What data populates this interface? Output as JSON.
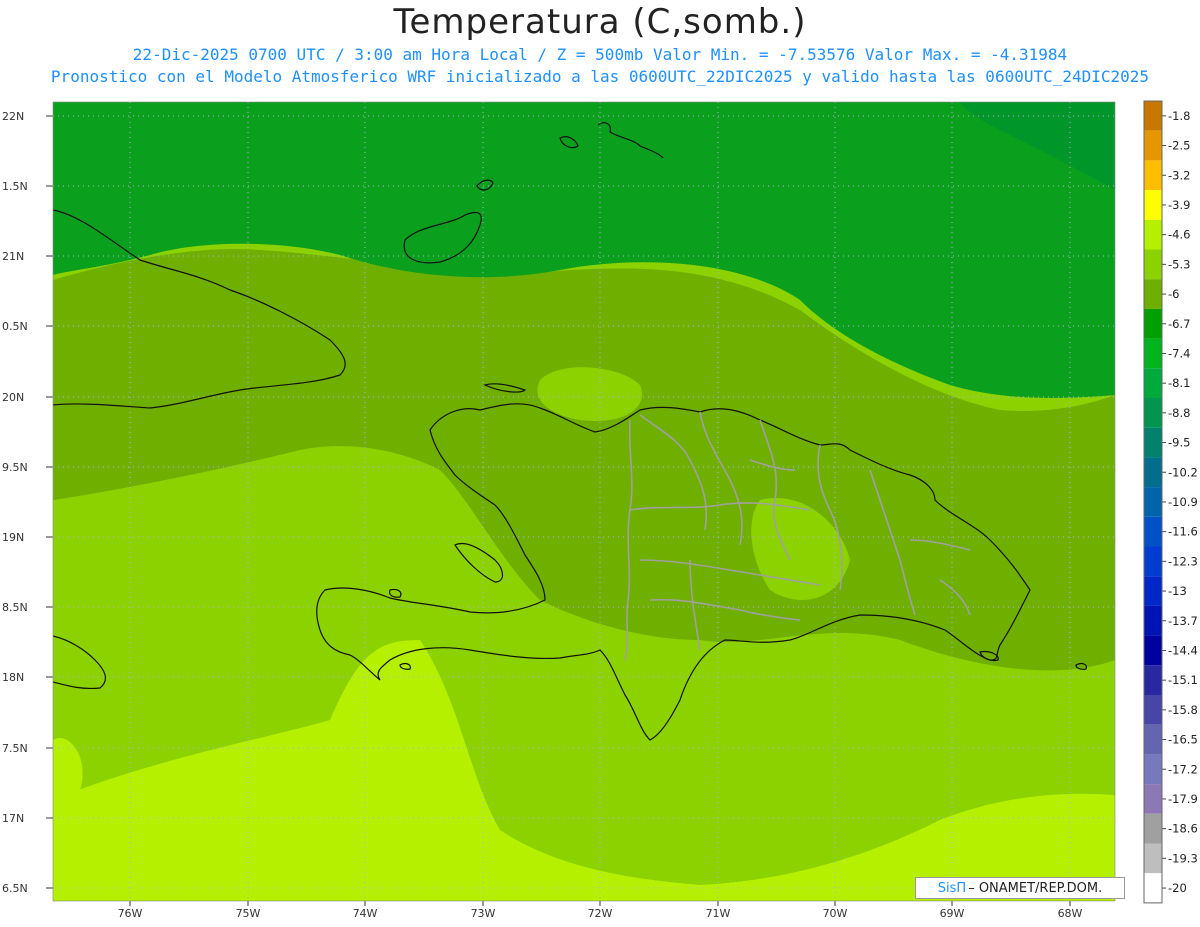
{
  "header": {
    "title": "Temperatura (C,somb.)",
    "subtitle_line1": "22-Dic-2025  0700 UTC / 3:00 am Hora Local / Z = 500mb  Valor Min. = -7.53576  Valor Max. = -4.31984",
    "subtitle_line2": "Pronostico con el Modelo Atmosferico WRF inicializado a las 0600UTC_22DIC2025 y valido hasta las  0600UTC_24DIC2025"
  },
  "axes": {
    "lat_labels": [
      "22N",
      "1.5N",
      "21N",
      "0.5N",
      "20N",
      "9.5N",
      "19N",
      "8.5N",
      "18N",
      "7.5N",
      "17N",
      "6.5N"
    ],
    "lon_labels": [
      "76W",
      "75W",
      "74W",
      "73W",
      "72W",
      "71W",
      "70W",
      "69W",
      "68W"
    ]
  },
  "colorbar": {
    "labels": [
      "-1.8",
      "-2.5",
      "-3.2",
      "-3.9",
      "-4.6",
      "-5.3",
      "-6",
      "-6.7",
      "-7.4",
      "-8.1",
      "-8.8",
      "-9.5",
      "-10.2",
      "-10.9",
      "-11.6",
      "-12.3",
      "-13",
      "-13.7",
      "-14.4",
      "-15.1",
      "-15.8",
      "-16.5",
      "-17.2",
      "-17.9",
      "-18.6",
      "-19.3",
      "-20"
    ],
    "colors": [
      "#c87800",
      "#e69600",
      "#ffbe00",
      "#ffff00",
      "#b4f000",
      "#8cd200",
      "#6eaf00",
      "#00a000",
      "#00b41e",
      "#00aa3c",
      "#009650",
      "#00826e",
      "#006e8c",
      "#0064aa",
      "#0050c8",
      "#003cd2",
      "#0028c8",
      "#0014b4",
      "#0000a0",
      "#2828a0",
      "#4646a6",
      "#6464b0",
      "#7878be",
      "#8c78b4",
      "#a0a0a0",
      "#bebebe",
      "#ffffff"
    ]
  },
  "credit": {
    "logo": "SisΠ",
    "text": "– ONAMET/REP.DOM."
  },
  "colors": {
    "subtitle": "#1e90ff",
    "north_band": "#0aa01e",
    "mid_band": "#6eaf00",
    "south_band": "#8cd200",
    "far_south": "#b4f000"
  }
}
